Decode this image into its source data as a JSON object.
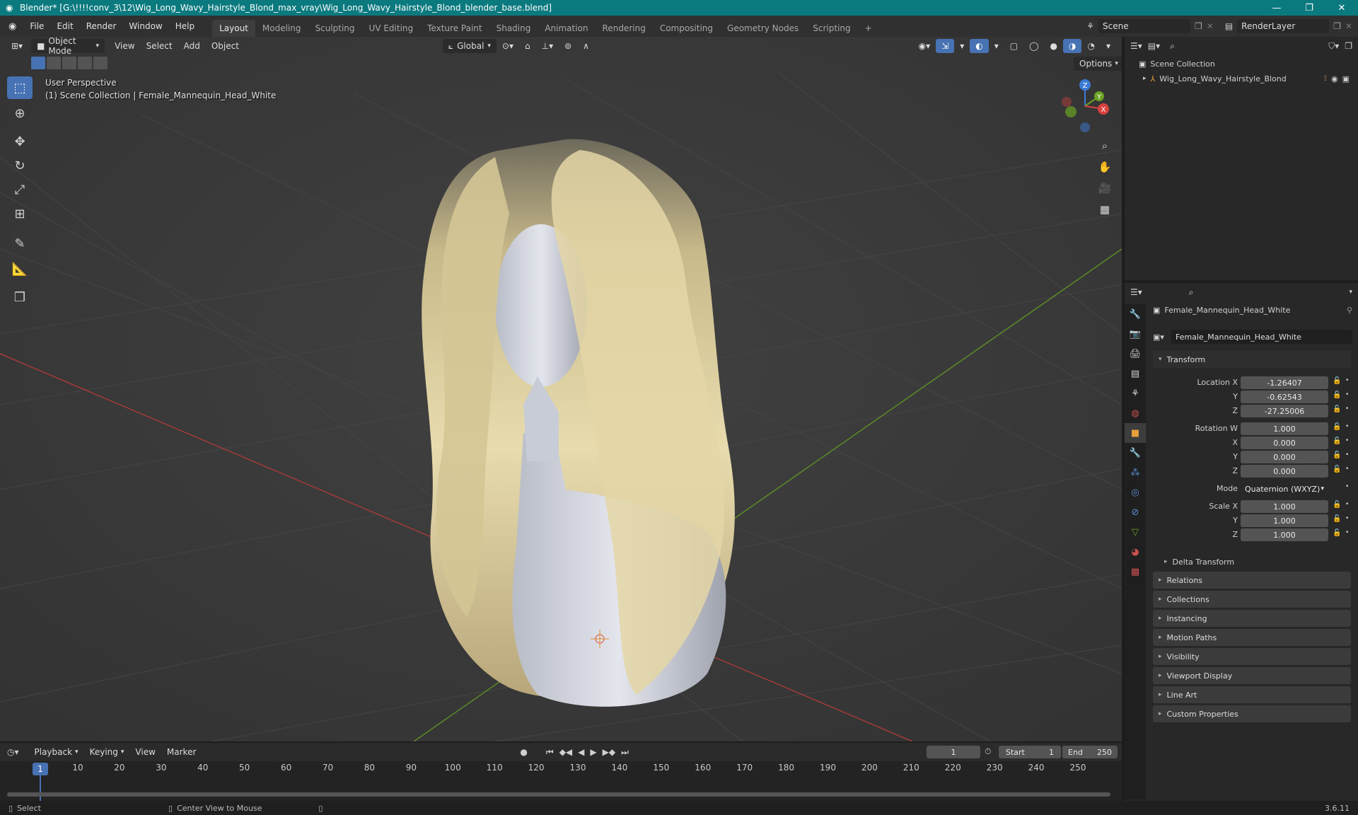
{
  "title_bar": {
    "title": "Blender* [G:\\!!!!conv_3\\12\\Wig_Long_Wavy_Hairstyle_Blond_max_vray\\Wig_Long_Wavy_Hairstyle_Blond_blender_base.blend]",
    "minimize": "—",
    "maximize": "❐",
    "close": "✕"
  },
  "menu": {
    "items": [
      "File",
      "Edit",
      "Render",
      "Window",
      "Help"
    ]
  },
  "workspaces": {
    "tabs": [
      "Layout",
      "Modeling",
      "Sculpting",
      "UV Editing",
      "Texture Paint",
      "Shading",
      "Animation",
      "Rendering",
      "Compositing",
      "Geometry Nodes",
      "Scripting"
    ],
    "active": "Layout",
    "add": "+"
  },
  "scene": {
    "name": "Scene",
    "view_layer": "RenderLayer"
  },
  "viewport": {
    "mode": "Object Mode",
    "menus": [
      "View",
      "Select",
      "Add",
      "Object"
    ],
    "transform_orientation": "Global",
    "options_label": "Options",
    "perspective_label": "User Perspective",
    "collection_label": "(1) Scene Collection | Female_Mannequin_Head_White",
    "gizmo": {
      "x": "X",
      "y": "Y",
      "z": "Z"
    }
  },
  "outliner": {
    "root": "Scene Collection",
    "items": [
      {
        "name": "Wig_Long_Wavy_Hairstyle_Blond"
      }
    ]
  },
  "properties": {
    "object_name": "Female_Mannequin_Head_White",
    "data_name": "Female_Mannequin_Head_White",
    "transform_label": "Transform",
    "location": {
      "label": "Location X",
      "x": "-1.26407",
      "y": "-0.62543",
      "z": "-27.25006"
    },
    "rotation": {
      "label": "Rotation W",
      "w": "1.000",
      "x": "0.000",
      "y": "0.000",
      "z": "0.000"
    },
    "mode": {
      "label": "Mode",
      "value": "Quaternion (WXYZ)"
    },
    "scale": {
      "label": "Scale X",
      "x": "1.000",
      "y": "1.000",
      "z": "1.000"
    },
    "axis_labels": {
      "x": "X",
      "y": "Y",
      "z": "Z"
    },
    "delta_transform": "Delta Transform",
    "panels": [
      "Relations",
      "Collections",
      "Instancing",
      "Motion Paths",
      "Visibility",
      "Viewport Display",
      "Line Art",
      "Custom Properties"
    ]
  },
  "timeline": {
    "menus": [
      "Playback",
      "Keying",
      "View",
      "Marker"
    ],
    "current_frame": "1",
    "start_label": "Start",
    "start": "1",
    "end_label": "End",
    "end": "250",
    "ticks": [
      "1",
      "10",
      "20",
      "30",
      "40",
      "50",
      "60",
      "70",
      "80",
      "90",
      "100",
      "110",
      "120",
      "130",
      "140",
      "150",
      "160",
      "170",
      "180",
      "190",
      "200",
      "210",
      "220",
      "230",
      "240",
      "250"
    ]
  },
  "status_bar": {
    "select": "Select",
    "center_view": "Center View to Mouse",
    "version": "3.6.11"
  },
  "colors": {
    "title_bar": "#0b7a7f",
    "accent": "#4772b3",
    "active_tab": "#3d3d3d",
    "x_axis": "#d8423e",
    "y_axis": "#6ba324",
    "z_axis": "#3b7bd6"
  }
}
